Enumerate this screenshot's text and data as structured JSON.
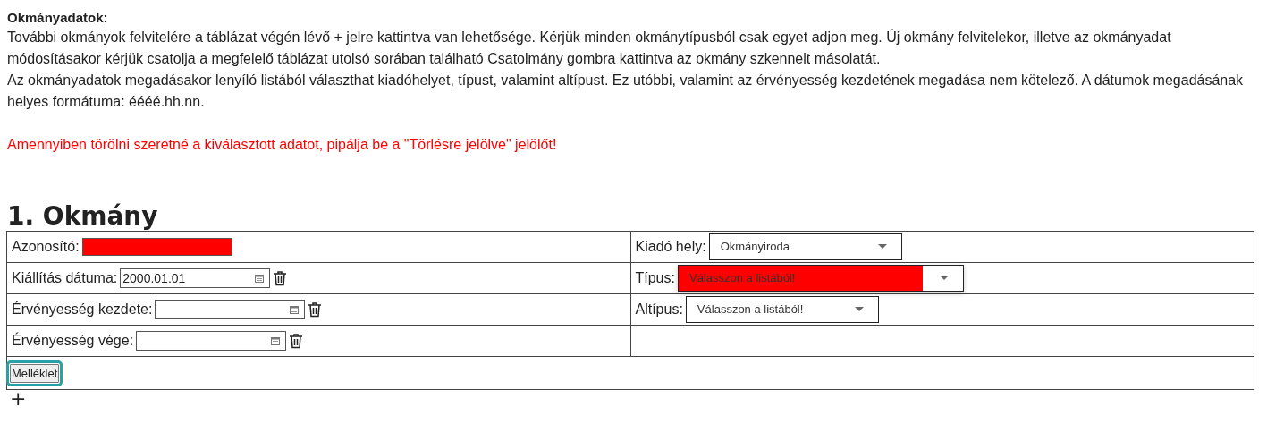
{
  "intro": {
    "title": "Okmányadatok:",
    "paragraphs": [
      "További okmányok felvitelére a táblázat végén lévő + jelre kattintva van lehetősége. Kérjük minden okmánytípusból csak egyet adjon meg. Új okmány felvitelekor, illetve az okmányadat módosításakor kérjük csatolja a megfelelő táblázat utolsó sorában található Csatolmány gombra kattintva az okmány szkennelt másolatát.",
      "Az okmányadatok megadásakor lenyíló listából választhat kiadóhelyet, típust, valamint altípust. Ez utóbbi, valamint az érvényesség kezdetének megadása nem kötelező. A dátumok megadásának helyes formátuma: éééé.hh.nn."
    ],
    "warning": "Amennyiben törölni szeretné a kiválasztott adatot, pipálja be a \"Törlésre jelölve\" jelölőt!"
  },
  "document": {
    "heading": "1. Okmány",
    "rows": [
      {
        "left": {
          "kind": "text",
          "label": "Azonosító:",
          "invalid": true
        },
        "right": {
          "kind": "select",
          "label": "Kiadó hely:",
          "value": "Okmányiroda",
          "invalid": false
        }
      },
      {
        "left": {
          "kind": "date",
          "label": "Kiállítás dátuma:",
          "value": "2000.01.01"
        },
        "right": {
          "kind": "select",
          "label": "Típus:",
          "value": "Válasszon a listából!",
          "invalid": true
        }
      },
      {
        "left": {
          "kind": "date",
          "label": "Érvényesség kezdete:"
        },
        "right": {
          "kind": "select",
          "label": "Altípus:",
          "value": "Válasszon a listából!",
          "invalid": false
        }
      },
      {
        "left": {
          "kind": "date",
          "label": "Érvényesség vége:"
        },
        "right": {
          "kind": "empty"
        }
      }
    ],
    "attach_button": {
      "label": "Melléklet",
      "focused": true
    },
    "add_button": "+"
  }
}
